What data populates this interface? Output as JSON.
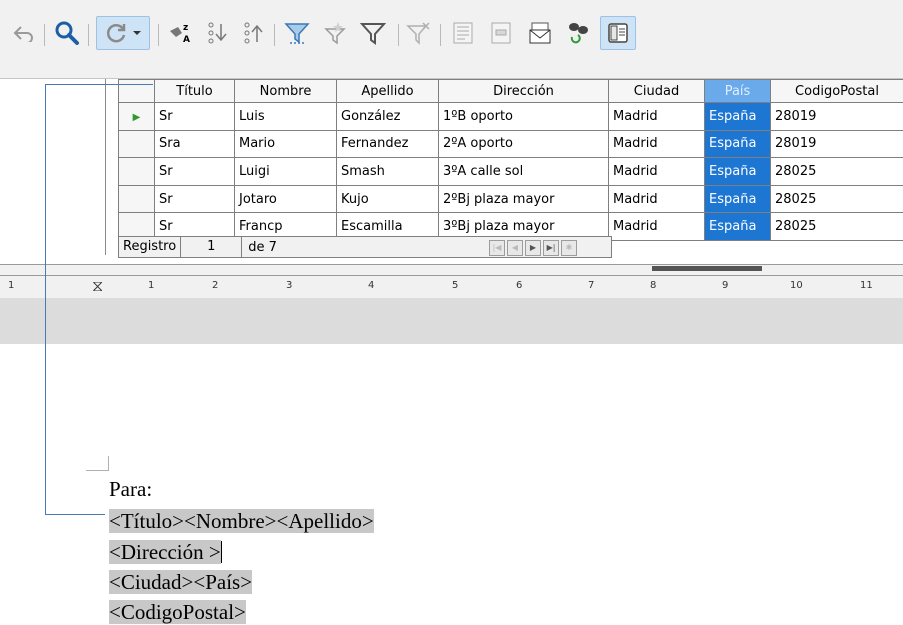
{
  "toolbar": {
    "buttons": [
      {
        "name": "undo-icon",
        "icon": "arrow-back"
      },
      {
        "name": "find-record-icon",
        "icon": "search"
      },
      {
        "name": "refresh-icon",
        "icon": "refresh"
      },
      {
        "name": "refresh-dropdown-icon",
        "icon": "chevron-down"
      },
      {
        "name": "sort-icon",
        "icon": "sort-az"
      },
      {
        "name": "sort-ascending-icon",
        "icon": "sort-ascending"
      },
      {
        "name": "sort-descending-icon",
        "icon": "sort-descending"
      },
      {
        "name": "autofilter-icon",
        "icon": "funnel-lines"
      },
      {
        "name": "apply-filter-icon",
        "icon": "funnel-star"
      },
      {
        "name": "standard-filter-icon",
        "icon": "funnel"
      },
      {
        "name": "reset-filter-icon",
        "icon": "funnel-x"
      },
      {
        "name": "data-to-text-icon",
        "icon": "doc-lines"
      },
      {
        "name": "data-to-fields-icon",
        "icon": "doc-fields"
      },
      {
        "name": "mail-merge-icon",
        "icon": "envelope"
      },
      {
        "name": "data-source-icon",
        "icon": "db-refresh"
      },
      {
        "name": "explorer-toggle-icon",
        "icon": "panel"
      }
    ]
  },
  "grid": {
    "columns": [
      "Título",
      "Nombre",
      "Apellido",
      "Dirección",
      "Ciudad",
      "País",
      "CodigoPostal"
    ],
    "selected_column": "País",
    "rows": [
      [
        "Sr",
        "Luis",
        "González",
        "1ºB oporto",
        "Madrid",
        "España",
        "28019"
      ],
      [
        "Sra",
        "Mario",
        "Fernandez",
        "2ºA oporto",
        "Madrid",
        "España",
        "28019"
      ],
      [
        "Sr",
        "Luigi",
        "Smash",
        "3ºA calle sol",
        "Madrid",
        "España",
        "28025"
      ],
      [
        "Sr",
        "Jotaro",
        "Kujo",
        "2ºBj plaza mayor",
        "Madrid",
        "España",
        "28025"
      ],
      [
        "Sr",
        "Francp",
        "Escamilla",
        "3ºBj plaza mayor",
        "Madrid",
        "España",
        "28025"
      ]
    ],
    "current_row_marker": "▶"
  },
  "navigator": {
    "label": "Registro",
    "current": "1",
    "of_text": "de 7",
    "buttons": [
      "|◀",
      "◀",
      "▶",
      "▶|",
      "✱"
    ]
  },
  "ruler": {
    "labels": [
      "1",
      "1",
      "2",
      "3",
      "4",
      "5",
      "6",
      "7",
      "8",
      "9",
      "10",
      "11"
    ]
  },
  "document": {
    "lines": [
      {
        "plain": "Para:"
      },
      {
        "field": "<Título><Nombre><Apellido>"
      },
      {
        "field": "<Dirección >"
      },
      {
        "field": "<Ciudad><País>"
      },
      {
        "field": "<CodigoPostal>"
      }
    ]
  },
  "colors": {
    "selected_header": "#6aa9ea",
    "highlight_cell": "#1e76d3",
    "field_shading": "#c8c8c8",
    "connector": "#4a7ab5"
  }
}
